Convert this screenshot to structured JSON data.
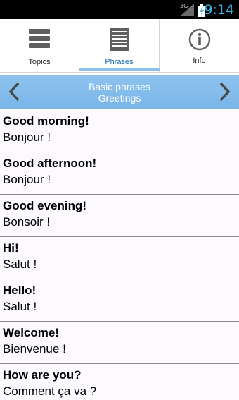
{
  "status_bar": {
    "network": "3G",
    "clock": "9:14"
  },
  "tabs": [
    {
      "label": "Topics",
      "icon": "list-icon",
      "selected": false
    },
    {
      "label": "Phrases",
      "icon": "document-lines-icon",
      "selected": true
    },
    {
      "label": "Info",
      "icon": "info-icon",
      "selected": false
    }
  ],
  "header": {
    "title": "Basic phrases",
    "subtitle": "Greetings",
    "prev_icon": "chevron-left-icon",
    "next_icon": "chevron-right-icon"
  },
  "phrases": [
    {
      "english": "Good morning!",
      "french": "Bonjour !"
    },
    {
      "english": "Good afternoon!",
      "french": "Bonjour !"
    },
    {
      "english": "Good evening!",
      "french": "Bonsoir !"
    },
    {
      "english": "Hi!",
      "french": "Salut !"
    },
    {
      "english": "Hello!",
      "french": "Salut !"
    },
    {
      "english": "Welcome!",
      "french": "Bienvenue !"
    },
    {
      "english": "How are you?",
      "french": "Comment ça va ?"
    }
  ],
  "colors": {
    "status_bar": "#000000",
    "clock": "#33b5e5",
    "header_bg": "#84bced",
    "tab_indicator": "#8fc0e8",
    "row_bg": "#fcfaff"
  }
}
